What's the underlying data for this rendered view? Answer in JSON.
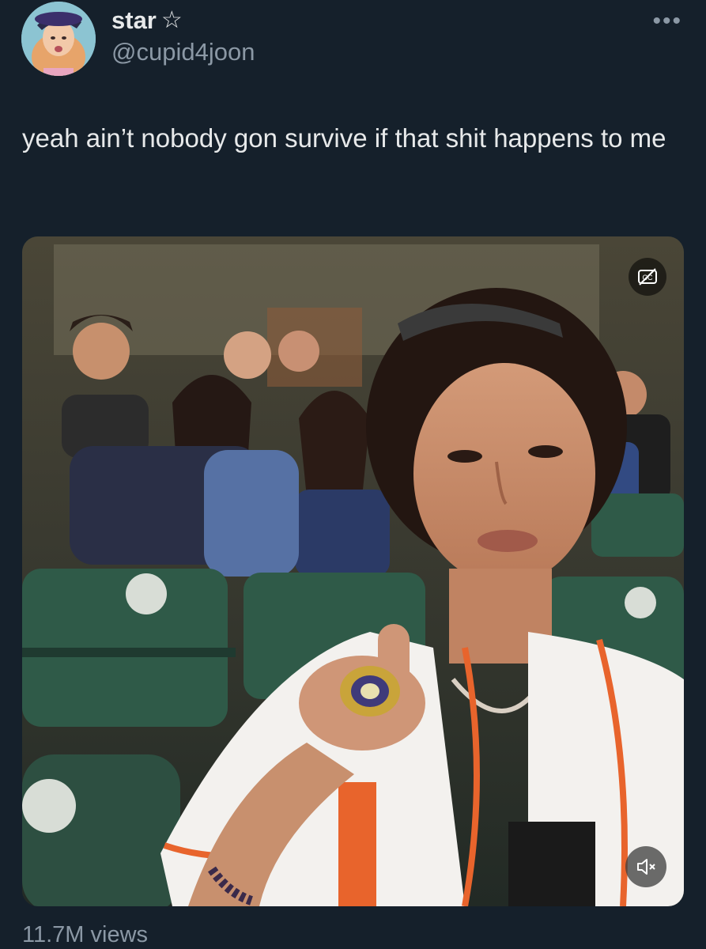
{
  "user": {
    "display_name": "star",
    "name_badge_icon": "star-outline-icon",
    "handle": "@cupid4joon"
  },
  "menu": {
    "more_icon": "more-dots-icon",
    "more_glyph": "•••"
  },
  "tweet": {
    "text": "yeah ain’t nobody gon survive if that shit happens to me"
  },
  "media": {
    "type": "video",
    "captions_icon": "closed-captions-off-icon",
    "mute_icon": "speaker-muted-icon",
    "jersey_accent": "#e8642c",
    "seat_color": "#2f5a48"
  },
  "stats": {
    "views": "11.7M views"
  },
  "colors": {
    "background": "#15202b",
    "primary_text": "#e7e9ea",
    "secondary_text": "#8b98a5"
  }
}
